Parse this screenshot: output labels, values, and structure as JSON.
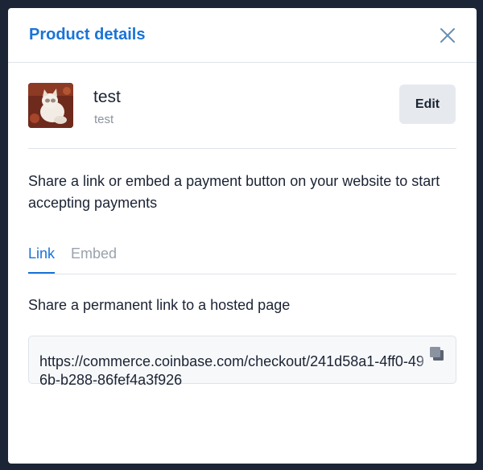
{
  "modal": {
    "title": "Product details"
  },
  "product": {
    "name": "test",
    "description": "test",
    "edit_label": "Edit"
  },
  "share_description": "Share a link or embed a payment button on your website to start accepting payments",
  "tabs": [
    {
      "label": "Link",
      "active": true
    },
    {
      "label": "Embed",
      "active": false
    }
  ],
  "link_panel": {
    "description": "Share a permanent link to a hosted page",
    "url": "https://commerce.coinbase.com/checkout/241d58a1-4ff0-496b-b288-86fef4a3f926"
  },
  "colors": {
    "accent": "#1a73d6",
    "backdrop": "#1c2536"
  }
}
